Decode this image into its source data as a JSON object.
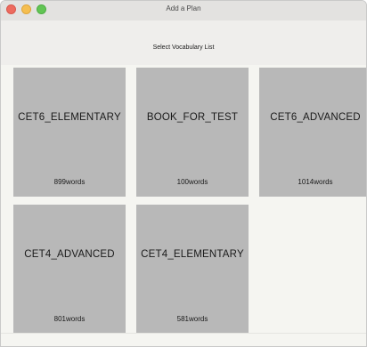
{
  "window": {
    "title": "Add a Plan"
  },
  "header": {
    "label": "Select Vocabulary List"
  },
  "cards": [
    {
      "name": "CET6_ELEMENTARY",
      "count": "899words"
    },
    {
      "name": "BOOK_FOR_TEST",
      "count": "100words"
    },
    {
      "name": "CET6_ADVANCED",
      "count": "1014words"
    },
    {
      "name": "CET4_ADVANCED",
      "count": "801words"
    },
    {
      "name": "CET4_ELEMENTARY",
      "count": "581words"
    }
  ]
}
